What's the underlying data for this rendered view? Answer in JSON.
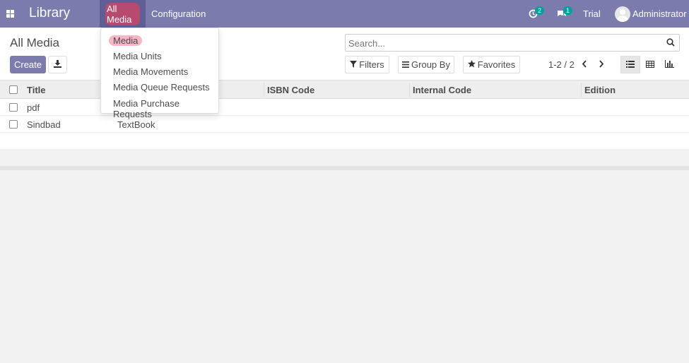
{
  "navbar": {
    "brand": "Library",
    "menus": [
      {
        "label": "All Media"
      },
      {
        "label": "Configuration"
      }
    ],
    "activities_count": "2",
    "messages_count": "1",
    "trial_label": "Trial",
    "user_name": "Administrator"
  },
  "control": {
    "page_title": "All Media",
    "create_label": "Create",
    "search_placeholder": "Search...",
    "filters_label": "Filters",
    "groupby_label": "Group By",
    "favorites_label": "Favorites",
    "pager": "1-2 / 2"
  },
  "dropdown": {
    "items": [
      {
        "label": "Media"
      },
      {
        "label": "Media Units"
      },
      {
        "label": "Media Movements"
      },
      {
        "label": "Media Queue Requests"
      },
      {
        "label": "Media Purchase Requests"
      }
    ]
  },
  "table": {
    "columns": [
      "Title",
      "",
      "ISBN Code",
      "Internal Code",
      "Edition"
    ],
    "rows": [
      {
        "title": "pdf",
        "type": "",
        "isbn": "",
        "internal": "",
        "edition": ""
      },
      {
        "title": "Sindbad",
        "type": "TextBook",
        "isbn": "",
        "internal": "",
        "edition": ""
      }
    ]
  },
  "colors": {
    "primary": "#7c7bad",
    "active_menu": "#5f5e97",
    "highlight": "#b74a6f",
    "badge": "#00a09d"
  }
}
